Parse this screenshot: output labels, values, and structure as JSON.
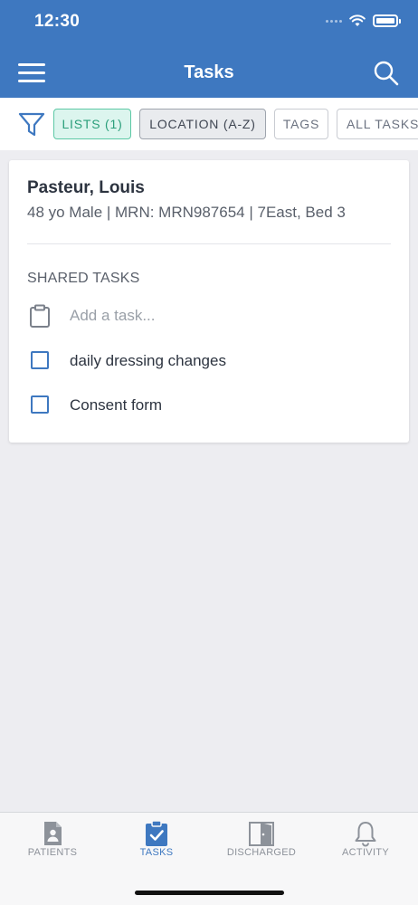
{
  "status_bar": {
    "time": "12:30"
  },
  "header": {
    "title": "Tasks"
  },
  "filters": {
    "lists": "LISTS (1)",
    "location": "LOCATION (A-Z)",
    "tags": "TAGS",
    "all_tasks": "ALL TASKS"
  },
  "patient": {
    "name": "Pasteur, Louis",
    "info": "48 yo Male | MRN: MRN987654 | 7East, Bed 3"
  },
  "shared_tasks": {
    "title": "SHARED TASKS",
    "add_placeholder": "Add a task...",
    "items": [
      {
        "label": "daily dressing changes"
      },
      {
        "label": "Consent form"
      }
    ]
  },
  "tabs": [
    {
      "label": "PATIENTS",
      "icon": "patient-file-icon"
    },
    {
      "label": "TASKS",
      "icon": "clipboard-check-icon",
      "active": true
    },
    {
      "label": "DISCHARGED",
      "icon": "door-icon"
    },
    {
      "label": "ACTIVITY",
      "icon": "bell-icon"
    }
  ],
  "colors": {
    "brand_blue": "#3e78c0",
    "lists_chip_green": "#5cc8a5",
    "background": "#ededf1"
  }
}
